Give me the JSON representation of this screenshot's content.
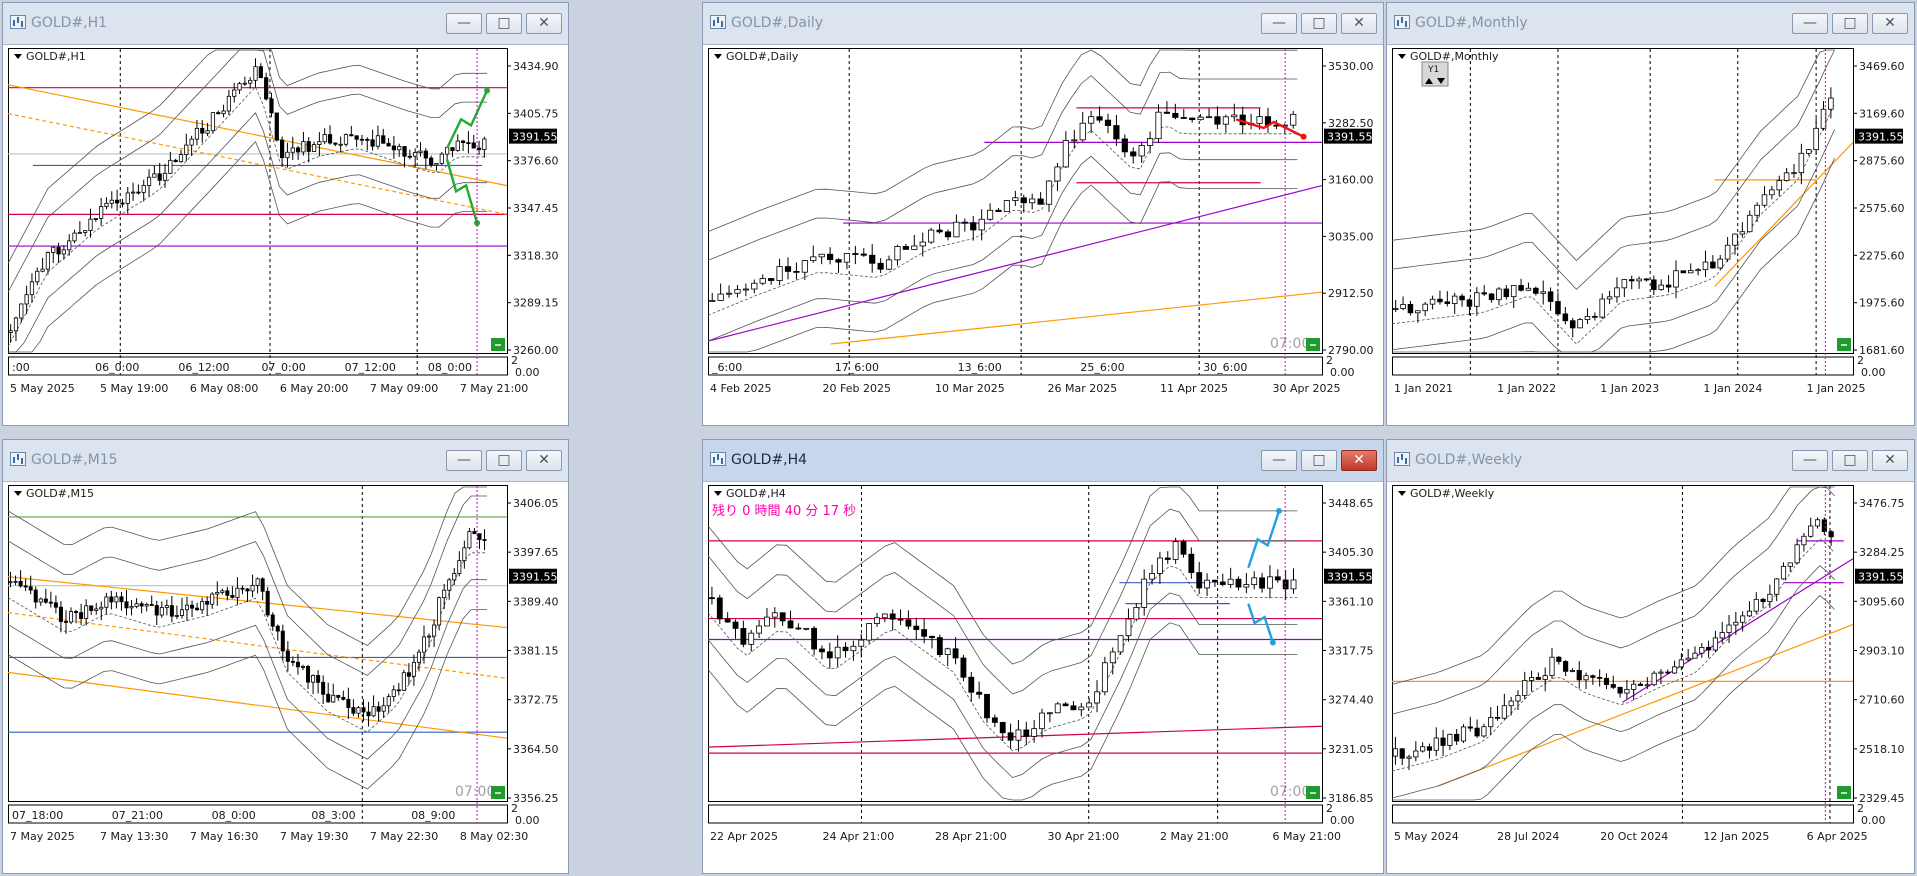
{
  "windows": [
    {
      "id": "h1",
      "title": "GOLD#,H1",
      "label": "GOLD#,H1",
      "price_scale": [
        "3434.90",
        "3405.75",
        "3376.60",
        "3347.45",
        "3318.30",
        "3289.15",
        "3260.00"
      ],
      "current_price": "3391.55",
      "time_axis": [
        "5 May 2025",
        "5 May 19:00",
        "6 May 08:00",
        "6 May 20:00",
        "7 May 09:00",
        "7 May 21:00"
      ],
      "session_labels": [
        ":00",
        "06_0:00",
        "06_12:00",
        "07_0:00",
        "07_12:00",
        "08_0:00"
      ],
      "sub_scale": [
        "2",
        "0.00"
      ]
    },
    {
      "id": "daily",
      "title": "GOLD#,Daily",
      "label": "GOLD#,Daily",
      "price_scale": [
        "3530.00",
        "3282.50",
        "3160.00",
        "3035.00",
        "2912.50",
        "2790.00"
      ],
      "current_price": "3391.55",
      "time_axis": [
        "4 Feb 2025",
        "20 Feb 2025",
        "10 Mar 2025",
        "26 Mar 2025",
        "11 Apr 2025",
        "30 Apr 2025"
      ],
      "session_labels": [
        "_6:00",
        "17_6:00",
        "13_6:00",
        "25_6:00",
        "30_6:00"
      ],
      "sub_scale": [
        "2",
        "0.00"
      ],
      "faded_time": "07:00"
    },
    {
      "id": "monthly",
      "title": "GOLD#,Monthly",
      "label": "GOLD#,Monthly",
      "price_scale": [
        "3469.60",
        "3169.60",
        "2875.60",
        "2575.60",
        "2275.60",
        "1975.60",
        "1681.60"
      ],
      "current_price": "3391.55",
      "time_axis": [
        "1 Jan 2021",
        "1 Jan 2022",
        "1 Jan 2023",
        "1 Jan 2024",
        "1 Jan 2025"
      ],
      "sub_scale": [
        "2",
        "0.00"
      ],
      "period_box": "Y1"
    },
    {
      "id": "m15",
      "title": "GOLD#,M15",
      "label": "GOLD#,M15",
      "price_scale": [
        "3406.05",
        "3397.65",
        "3389.40",
        "3381.15",
        "3372.75",
        "3364.50",
        "3356.25"
      ],
      "current_price": "3391.55",
      "time_axis": [
        "7 May 2025",
        "7 May 13:30",
        "7 May 16:30",
        "7 May 19:30",
        "7 May 22:30",
        "8 May 02:30"
      ],
      "session_labels": [
        "07_18:00",
        "07_21:00",
        "08_0:00",
        "08_3:00",
        "08_9:00"
      ],
      "sub_scale": [
        "2",
        "0.00"
      ],
      "faded_time": "07:00"
    },
    {
      "id": "h4",
      "title": "GOLD#,H4",
      "label": "GOLD#,H4",
      "countdown": "残り 0 時間 40 分 17 秒",
      "price_scale": [
        "3448.65",
        "3405.30",
        "3361.10",
        "3317.75",
        "3274.40",
        "3231.05",
        "3186.85"
      ],
      "current_price": "3391.55",
      "time_axis": [
        "22 Apr 2025",
        "24 Apr 21:00",
        "28 Apr 21:00",
        "30 Apr 21:00",
        "2 May 21:00",
        "6 May 21:00"
      ],
      "sub_scale": [
        "2",
        "0.00"
      ],
      "faded_time": "07:00"
    },
    {
      "id": "weekly",
      "title": "GOLD#,Weekly",
      "label": "GOLD#,Weekly",
      "price_scale": [
        "3476.75",
        "3284.25",
        "3095.60",
        "2903.10",
        "2710.60",
        "2518.10",
        "2329.45"
      ],
      "current_price": "3391.55",
      "time_axis": [
        "5 May 2024",
        "28 Jul 2024",
        "20 Oct 2024",
        "12 Jan 2025",
        "6 Apr 2025"
      ],
      "sub_scale": [
        "2",
        "0.00"
      ]
    }
  ],
  "window_buttons": {
    "minimize": "—",
    "maximize": "□",
    "close": "✕"
  },
  "colors": {
    "bull": "#ffffff",
    "bear": "#000000",
    "candle_outline": "#000000",
    "trend_orange": "#ff9900",
    "level_red": "#d2004b",
    "level_magenta": "#9900cc",
    "level_blue": "#3060c0",
    "level_green": "#60a040",
    "arrow_green": "#22aa33",
    "arrow_red": "#ee1111",
    "arrow_blue": "#22a0e0",
    "current_line": "#c0c0c0",
    "countdown": "#ff00aa"
  }
}
